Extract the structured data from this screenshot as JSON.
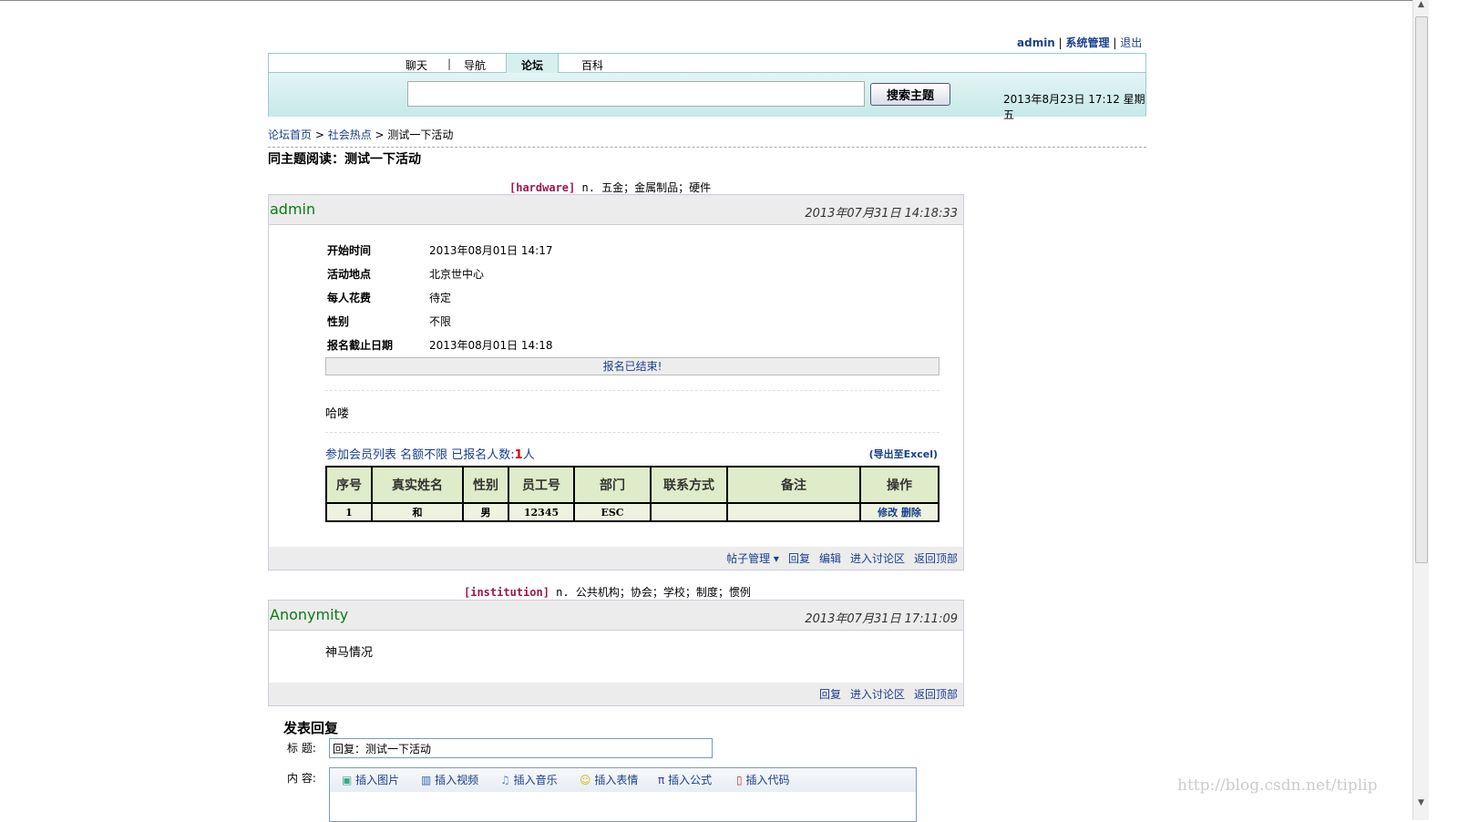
{
  "user": {
    "name": "admin",
    "admin": "系统管理",
    "logout": "退出"
  },
  "tabs": [
    "聊天",
    "导航",
    "论坛",
    "百科"
  ],
  "search": {
    "value": "",
    "button": "搜索主题",
    "datetime": "2013年8月23日 17:12 星期五"
  },
  "breadcrumb": [
    "论坛首页",
    "社会热点",
    "测试一下活动"
  ],
  "page_title": "同主题阅读：测试一下活动",
  "dict1": {
    "word": "[hardware]",
    "def": "n. 五金；金属制品；硬件"
  },
  "dict2": {
    "word": "[institution]",
    "def": "n. 公共机构；协会；学校；制度；惯例"
  },
  "post1": {
    "author": "admin",
    "time": "2013年07月31日 14:18:33",
    "fields": [
      {
        "k": "开始时间",
        "v": "2013年08月01日 14:17"
      },
      {
        "k": "活动地点",
        "v": "北京世中心"
      },
      {
        "k": "每人花费",
        "v": "待定"
      },
      {
        "k": "性别",
        "v": "不限"
      },
      {
        "k": "报名截止日期",
        "v": "2013年08月01日 14:18"
      }
    ],
    "ended": "报名已结束!",
    "body": "哈喽",
    "members_title": "参加会员列表 名额不限 已报名人数:",
    "members_count": "1",
    "members_unit": "人",
    "export": "(导出至Excel)",
    "columns": [
      "序号",
      "真实姓名",
      "性别",
      "员工号",
      "部门",
      "联系方式",
      "备注",
      "操作"
    ],
    "rows": [
      [
        "1",
        "和",
        "男",
        "12345",
        "ESC",
        "",
        ""
      ]
    ],
    "row_actions": [
      "修改",
      "删除"
    ],
    "footer": [
      "帖子管理 ▾",
      "回复",
      "编辑",
      "进入讨论区",
      "返回顶部"
    ]
  },
  "post2": {
    "author": "Anonymity",
    "time": "2013年07月31日 17:11:09",
    "body": "神马情况",
    "footer": [
      "回复",
      "进入讨论区",
      "返回顶部"
    ]
  },
  "reply": {
    "heading": "发表回复",
    "title_label": "标 题:",
    "title_value": "回复：测试一下活动",
    "content_label": "内 容:",
    "tools": [
      "插入图片",
      "插入视频",
      "插入音乐",
      "插入表情",
      "插入公式",
      "插入代码"
    ]
  },
  "watermark": "http://blog.csdn.net/tiplip"
}
